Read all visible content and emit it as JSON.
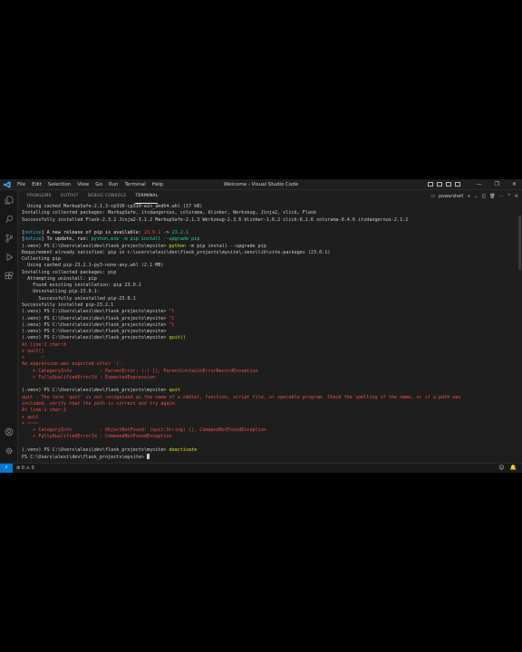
{
  "window": {
    "title": "Welcome - Visual Studio Code"
  },
  "menu": [
    "File",
    "Edit",
    "Selection",
    "View",
    "Go",
    "Run",
    "Terminal",
    "Help"
  ],
  "panel": {
    "tabs": [
      {
        "label": "PROBLEMS"
      },
      {
        "label": "OUTPUT"
      },
      {
        "label": "DEBUG CONSOLE"
      },
      {
        "label": "TERMINAL",
        "active": true
      }
    ],
    "shell": "powershell"
  },
  "terminal": {
    "lines": [
      {
        "text": "  Using cached MarkupSafe-2.1.3-cp310-cp310-win_amd64.whl (17 kB)"
      },
      {
        "text": "Installing collected packages: MarkupSafe, itsdangerous, colorama, blinker, Werkzeug, Jinja2, click, Flask"
      },
      {
        "text": "Successfully installed Flask-2.3.2 Jinja2-3.1.2 MarkupSafe-2.1.3 Werkzeug-2.3.6 blinker-1.6.2 click-8.1.6 colorama-0.4.6 itsdangerous-2.1.2"
      },
      {
        "text": ""
      },
      {
        "segments": [
          {
            "t": "[",
            "c": "w"
          },
          {
            "t": "notice",
            "c": "c"
          },
          {
            "t": "] A new release of pip is available: ",
            "c": "w"
          },
          {
            "t": "23.0.1",
            "c": "r"
          },
          {
            "t": " -> ",
            "c": "w"
          },
          {
            "t": "23.2.1",
            "c": "g"
          }
        ]
      },
      {
        "segments": [
          {
            "t": "[",
            "c": "w"
          },
          {
            "t": "notice",
            "c": "c"
          },
          {
            "t": "] To update, run: ",
            "c": "w"
          },
          {
            "t": "python.exe -m pip install --upgrade pip",
            "c": "g"
          }
        ]
      },
      {
        "dot": "blue",
        "segments": [
          {
            "t": "(.venv) PS C:\\Users\\alexi\\dev\\flask_projects\\mysite> "
          },
          {
            "t": "python",
            "c": "y"
          },
          {
            "t": " -m pip install --upgrade pip"
          }
        ]
      },
      {
        "text": "Requirement already satisfied: pip in c:\\users\\alexi\\dev\\flask_projects\\mysite\\.venv\\lib\\site-packages (23.0.1)"
      },
      {
        "text": "Collecting pip"
      },
      {
        "text": "  Using cached pip-23.2.1-py3-none-any.whl (2.1 MB)"
      },
      {
        "text": "Installing collected packages: pip"
      },
      {
        "text": "  Attempting uninstall: pip"
      },
      {
        "text": "    Found existing installation: pip 23.0.1"
      },
      {
        "text": "    Uninstalling pip-23.0.1:"
      },
      {
        "text": "      Successfully uninstalled pip-23.0.1"
      },
      {
        "text": "Successfully installed pip-23.2.1"
      },
      {
        "dot": "ring",
        "segments": [
          {
            "t": "(.venv) PS C:\\Users\\alexi\\dev\\flask_projects\\mysite> "
          },
          {
            "t": "^C",
            "c": "r"
          }
        ]
      },
      {
        "dot": "ring",
        "segments": [
          {
            "t": "(.venv) PS C:\\Users\\alexi\\dev\\flask_projects\\mysite> "
          },
          {
            "t": "^C",
            "c": "r"
          }
        ]
      },
      {
        "dot": "ring",
        "segments": [
          {
            "t": "(.venv) PS C:\\Users\\alexi\\dev\\flask_projects\\mysite> "
          },
          {
            "t": "^C",
            "c": "r"
          }
        ]
      },
      {
        "dot": "red",
        "segments": [
          {
            "t": "(.venv) PS C:\\Users\\alexi\\dev\\flask_projects\\mysite>"
          }
        ]
      },
      {
        "segments": [
          {
            "t": "(.venv) PS C:\\Users\\alexi\\dev\\flask_projects\\mysite> "
          },
          {
            "t": "quit()",
            "c": "y"
          }
        ]
      },
      {
        "segments": [
          {
            "t": "At line:1 char:6",
            "c": "r"
          }
        ]
      },
      {
        "segments": [
          {
            "t": "+ quit()",
            "c": "r"
          }
        ]
      },
      {
        "segments": [
          {
            "t": "+      ~",
            "c": "r"
          }
        ]
      },
      {
        "segments": [
          {
            "t": "An expression was expected after '('.",
            "c": "r"
          }
        ]
      },
      {
        "segments": [
          {
            "t": "    + CategoryInfo          : ParserError: (:) [], ParentContainsErrorRecordException",
            "c": "r"
          }
        ]
      },
      {
        "segments": [
          {
            "t": "    + FullyQualifiedErrorId : ExpectedExpression",
            "c": "r"
          }
        ]
      },
      {
        "text": ""
      },
      {
        "dot": "red",
        "segments": [
          {
            "t": "(.venv) PS C:\\Users\\alexi\\dev\\flask_projects\\mysite> "
          },
          {
            "t": "quit",
            "c": "y"
          }
        ]
      },
      {
        "segments": [
          {
            "t": "quit : The term 'quit' is not recognized as the name of a cmdlet, function, script file, or operable program. Check the spelling of the name, or if a path was",
            "c": "r"
          }
        ]
      },
      {
        "segments": [
          {
            "t": "included, verify that the path is correct and try again.",
            "c": "r"
          }
        ]
      },
      {
        "segments": [
          {
            "t": "At line:1 char:1",
            "c": "r"
          }
        ]
      },
      {
        "segments": [
          {
            "t": "+ quit",
            "c": "r"
          }
        ]
      },
      {
        "segments": [
          {
            "t": "+ ~~~~",
            "c": "r"
          }
        ]
      },
      {
        "segments": [
          {
            "t": "    + CategoryInfo          : ObjectNotFound: (quit:String) [], CommandNotFoundException",
            "c": "r"
          }
        ]
      },
      {
        "segments": [
          {
            "t": "    + FullyQualifiedErrorId : CommandNotFoundException",
            "c": "r"
          }
        ]
      },
      {
        "text": ""
      },
      {
        "dot": "ring",
        "segments": [
          {
            "t": "(.venv) PS C:\\Users\\alexi\\dev\\flask_projects\\mysite> "
          },
          {
            "t": "deactivate",
            "c": "y"
          }
        ]
      },
      {
        "cursor": true,
        "segments": [
          {
            "t": "PS C:\\Users\\alexi\\dev\\flask_projects\\mysite> "
          }
        ]
      }
    ]
  },
  "statusbar": {
    "problems": "⊗ 0 ⚠ 0"
  },
  "colors": {
    "accent": "#0078d4",
    "error": "#f14c4c",
    "success": "#23d18b",
    "command": "#e5e510",
    "info": "#29b8db"
  }
}
